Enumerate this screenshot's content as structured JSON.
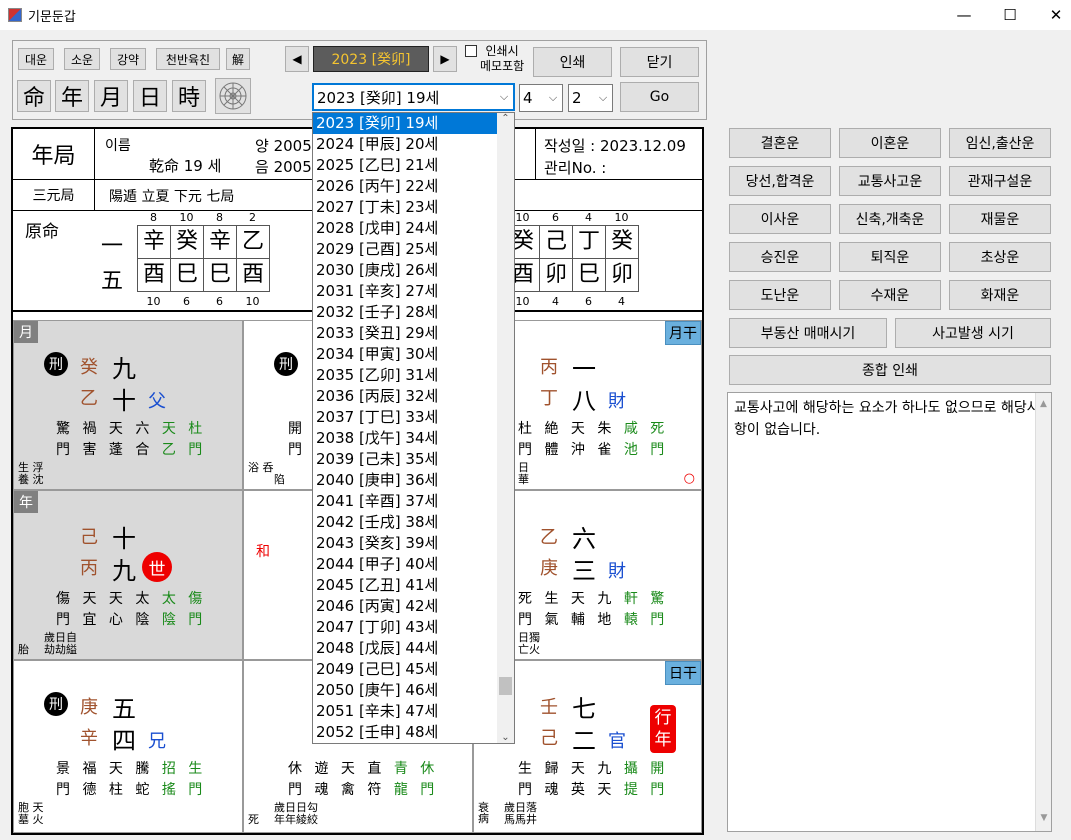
{
  "window": {
    "title": "기문둔갑",
    "min": "—",
    "max": "☐",
    "close": "✕"
  },
  "controls": {
    "small_buttons": [
      "대운",
      "소운",
      "강약",
      "천반육친",
      "解"
    ],
    "kanji_buttons": [
      "命",
      "年",
      "月",
      "日",
      "時"
    ],
    "prev": "◀",
    "next": "▶",
    "year_display": "2023 [癸卯]",
    "memo_checkbox": "인쇄시\n메모포함",
    "print": "인쇄",
    "close": "닫기",
    "go": "Go",
    "age_combo": "2023 [癸卯] 19세",
    "combo2": "4",
    "combo3": "2"
  },
  "chart": {
    "title": "年局",
    "name_label": "이름",
    "qianming": "乾命 19 세",
    "yang": "양 2005",
    "yin": "음 2005",
    "written_date": "작성일 : 2023.12.09",
    "manage_no": "관리No. :",
    "sanyuan": "三元局",
    "yangdun": "陽遁 立夏 下元 七局",
    "yuanming": "原命",
    "left_nums": [
      "一",
      "五"
    ],
    "left_top_nums": [
      "8",
      "10",
      "8",
      "2"
    ],
    "left_top": [
      "辛",
      "癸",
      "辛",
      "乙"
    ],
    "left_bot": [
      "酉",
      "巳",
      "巳",
      "酉"
    ],
    "left_bot_nums": [
      "10",
      "6",
      "6",
      "10"
    ],
    "right_top_nums": [
      "10",
      "6",
      "4",
      "10"
    ],
    "right_top": [
      "癸",
      "己",
      "丁",
      "癸"
    ],
    "right_bot": [
      "酉",
      "卯",
      "巳",
      "卯"
    ],
    "right_bot_nums": [
      "10",
      "4",
      "6",
      "4"
    ]
  },
  "palaces": {
    "p1": {
      "tag": "月",
      "badge": "刑",
      "s1": "癸",
      "s2": "乙",
      "n1": "九",
      "n2": "十",
      "rel": "父",
      "r1": "驚 禍 天 六 天 杜",
      "r2": "門 害 蓬 合 乙 門",
      "b1": "生 浮",
      "b2": "養 沈"
    },
    "p2": {
      "badge": "刑",
      "r1": "開",
      "r2": "門",
      "b1": "浴 呑",
      "b2": "陷"
    },
    "p3": {
      "tag": "月干",
      "s1": "丙",
      "s2": "丁",
      "n1": "一",
      "n2": "八",
      "rel": "財",
      "r1": "杜 絶 天 朱 咸 死",
      "r2": "門 體 沖 雀 池 門",
      "b1": "日",
      "b2": "華",
      "circle": "○"
    },
    "p4": {
      "tag": "年",
      "s1": "己",
      "s2": "丙",
      "n1": "十",
      "n2": "九",
      "sei": "世",
      "r1": "傷 天 天 太 太 傷",
      "r2": "門 宜 心 陰 陰 門",
      "b0": "胎",
      "b1": "歲日自",
      "b2": "劫劫縊"
    },
    "p5": {
      "he": "和"
    },
    "p6": {
      "s1": "乙",
      "s2": "庚",
      "n1": "六",
      "n2": "三",
      "rel": "財",
      "r1": "死 生 天 九 軒 驚",
      "r2": "門 氣 輔 地 轅 門",
      "b1": "日獨",
      "b2": "亡火"
    },
    "p7": {
      "badge": "刑",
      "s1": "庚",
      "s2": "辛",
      "n1": "五",
      "n2": "四",
      "rel": "兄",
      "r1": "景 福 天 騰 招 生",
      "r2": "門 德 柱 蛇 搖 門",
      "b1": "胞 天",
      "b2": "墓 火"
    },
    "p8": {
      "r1": "休 遊 天 直 青 休",
      "r2": "門 魂 禽 符 龍 門",
      "b0": "死",
      "b1": "歲日日勾",
      "b2": "年年綾絞"
    },
    "p9": {
      "tag": "日干",
      "s1": "壬",
      "s2": "己",
      "n1": "七",
      "n2": "二",
      "rel": "官",
      "hang": "行年",
      "r1": "生 歸 天 九 攝 開",
      "r2": "門 魂 英 天 提 門",
      "b0": "衰病",
      "b1": "歲日落",
      "b2": "馬馬井"
    }
  },
  "right_buttons": [
    [
      "결혼운",
      "이혼운",
      "임신,출산운"
    ],
    [
      "당선,합격운",
      "교통사고운",
      "관재구설운"
    ],
    [
      "이사운",
      "신축,개축운",
      "재물운"
    ],
    [
      "승진운",
      "퇴직운",
      "초상운"
    ],
    [
      "도난운",
      "수재운",
      "화재운"
    ]
  ],
  "wide_buttons": [
    "부동산 매매시기",
    "사고발생 시기"
  ],
  "print_all": "종합 인쇄",
  "memo_text": "교통사고에 해당하는 요소가 하나도 없으므로 해당사항이 없습니다.",
  "dropdown_items": [
    "2023 [癸卯] 19세",
    "2024 [甲辰] 20세",
    "2025 [乙巳] 21세",
    "2026 [丙午] 22세",
    "2027 [丁未] 23세",
    "2028 [戊申] 24세",
    "2029 [己酉] 25세",
    "2030 [庚戌] 26세",
    "2031 [辛亥] 27세",
    "2032 [壬子] 28세",
    "2033 [癸丑] 29세",
    "2034 [甲寅] 30세",
    "2035 [乙卯] 31세",
    "2036 [丙辰] 32세",
    "2037 [丁巳] 33세",
    "2038 [戊午] 34세",
    "2039 [己未] 35세",
    "2040 [庚申] 36세",
    "2041 [辛酉] 37세",
    "2042 [壬戌] 38세",
    "2043 [癸亥] 39세",
    "2044 [甲子] 40세",
    "2045 [乙丑] 41세",
    "2046 [丙寅] 42세",
    "2047 [丁卯] 43세",
    "2048 [戊辰] 44세",
    "2049 [己巳] 45세",
    "2050 [庚午] 46세",
    "2051 [辛未] 47세",
    "2052 [壬申] 48세"
  ],
  "colors": {
    "selection": "#0078d7",
    "year_bg": "#5c5c5c",
    "year_fg": "#f4c430",
    "tag_blue": "#6ab0de",
    "red": "#e00",
    "green": "#1a8a1a",
    "brown": "#a0522d"
  }
}
